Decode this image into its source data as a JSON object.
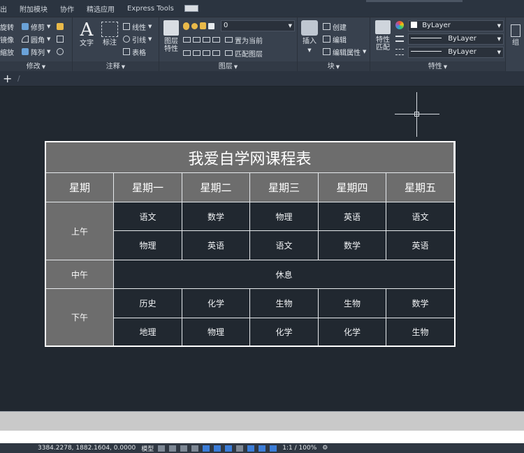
{
  "menubar": {
    "items": [
      "出",
      "附加模块",
      "协作",
      "精选应用",
      "Express Tools"
    ]
  },
  "ribbon": {
    "modify": {
      "rotate": "旋转",
      "trim": "修剪",
      "mirror": "镜像",
      "fillet": "圆角",
      "scale": "缩放",
      "array": "阵列",
      "title": "修改"
    },
    "annotation": {
      "text": "文字",
      "dimension": "标注",
      "linear": "线性",
      "leader": "引线",
      "table": "表格",
      "title": "注释"
    },
    "layers": {
      "layer_props": "图层\n特性",
      "layer_value": "0",
      "set_current": "置为当前",
      "match_layer": "匹配图层",
      "title": "图层"
    },
    "block": {
      "insert": "插入",
      "create": "创建",
      "edit": "编辑",
      "edit_attributes": "编辑属性",
      "title": "块"
    },
    "properties": {
      "match": "特性\n匹配",
      "color": "ByLayer",
      "linetype": "ByLayer",
      "lineweight": "ByLayer",
      "title": "特性"
    },
    "groups": {
      "label": "组"
    }
  },
  "tabs": {
    "new_tab": "+"
  },
  "schedule": {
    "title": "我爱自学网课程表",
    "header": [
      "星期",
      "星期一",
      "星期二",
      "星期三",
      "星期四",
      "星期五"
    ],
    "morning_label": "上午",
    "morning": [
      [
        "语文",
        "数学",
        "物理",
        "英语",
        "语文"
      ],
      [
        "物理",
        "英语",
        "语文",
        "数学",
        "英语"
      ]
    ],
    "noon_label": "中午",
    "noon_text": "休息",
    "afternoon_label": "下午",
    "afternoon": [
      [
        "历史",
        "化学",
        "生物",
        "生物",
        "数学"
      ],
      [
        "地理",
        "物理",
        "化学",
        "化学",
        "生物"
      ]
    ]
  },
  "status": {
    "coords": "3384.2278, 1882.1604, 0.0000",
    "model": "模型",
    "scale": "1:1 / 100%"
  },
  "colors": {
    "canvas": "#212830",
    "ribbon": "#38414e",
    "table_header": "#6d6d6d",
    "table_border": "#ffffff"
  }
}
